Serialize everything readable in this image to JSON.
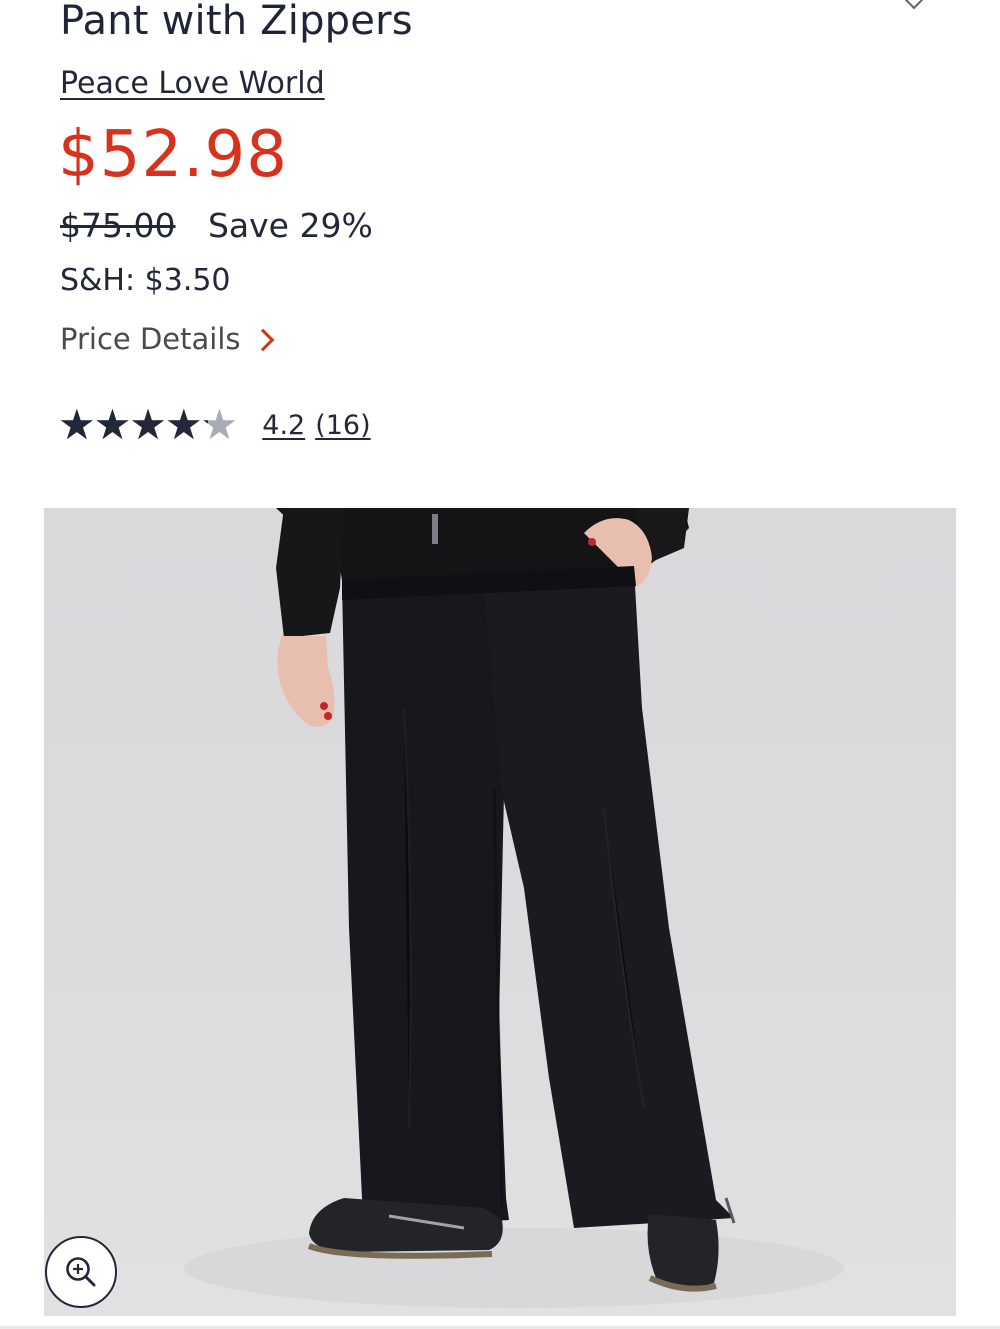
{
  "product": {
    "title": "Pant with Zippers",
    "brand": "Peace Love World",
    "price": "$52.98",
    "original_price": "$75.00",
    "savings": "Save 29%",
    "shipping": "S&H: $3.50",
    "price_details_label": "Price Details"
  },
  "rating": {
    "stars_value": 4.2,
    "stars_max": 5,
    "score_text": "4.2",
    "count_text": "(16)"
  },
  "image": {
    "zoom_icon": "zoom-in-icon"
  },
  "colors": {
    "price": "#d7321c",
    "text": "#23273a",
    "chevron": "#d7321c"
  }
}
